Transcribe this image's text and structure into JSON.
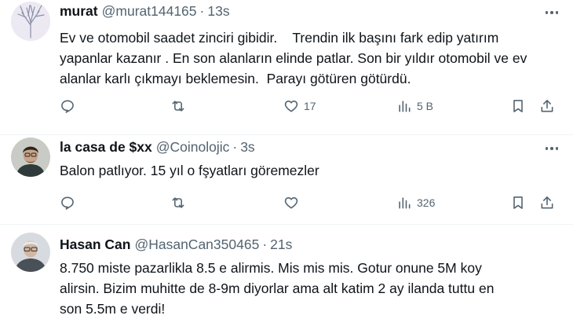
{
  "tweets": [
    {
      "name": "murat",
      "handle": "@murat144165",
      "dot": "·",
      "time": "13s",
      "text": "Ev ve otomobil saadet zinciri gibidir.    Trendin ilk başını fark edip yatırım\nyapanlar kazanır . En son alanların elinde patlar. Son bir yıldır otomobil ve ev\nalanlar karlı çıkmayı beklemesin.  Parayı götüren götürdü.",
      "likes": "17",
      "views": "5 B"
    },
    {
      "name": "la casa de $xx",
      "handle": "@Coinolojic",
      "dot": "·",
      "time": "3s",
      "text": "Balon patlıyor. 15 yıl o fşyatları göremezler",
      "likes": "",
      "views": "326"
    },
    {
      "name": "Hasan Can",
      "handle": "@HasanCan350465",
      "dot": "·",
      "time": "21s",
      "text": "8.750 miste pazarlikla 8.5 e alirmis. Mis mis mis. Gotur onune 5M koy\nalirsin. Bizim muhitte de 8-9m diyorlar ama alt katim 2 ay ilanda tuttu en\nson 5.5m e verdi!"
    }
  ],
  "icons": {
    "reply": "reply-icon",
    "retweet": "retweet-icon",
    "like": "heart-icon",
    "views": "views-icon",
    "bookmark": "bookmark-icon",
    "share": "share-icon",
    "more": "more-icon"
  },
  "colors": {
    "text": "#0f1419",
    "secondary": "#536471",
    "divider": "#eff3f4"
  }
}
